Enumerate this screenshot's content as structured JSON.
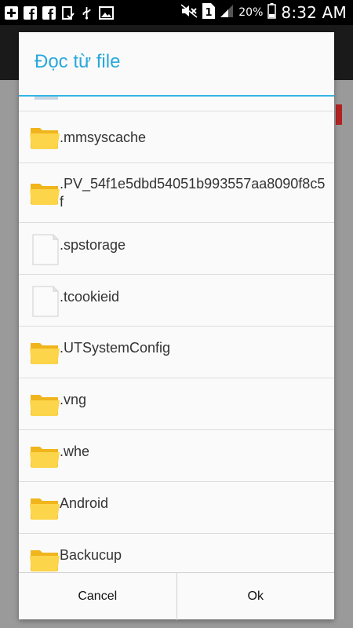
{
  "status_bar": {
    "battery_percent": "20%",
    "time": "8:32 AM",
    "left_icons": [
      "plus-icon",
      "facebook-icon",
      "facebook-icon",
      "clipboard-check-icon",
      "usb-icon",
      "image-icon"
    ],
    "right_icons": [
      "mute-icon",
      "sim-1-icon",
      "signal-icon",
      "battery-icon"
    ]
  },
  "dialog": {
    "title": "Đọc từ file",
    "items": [
      {
        "name": ".mmsyscache",
        "kind": "folder"
      },
      {
        "name": ".PV_54f1e5dbd54051b993557aa8090f8c5f",
        "kind": "folder"
      },
      {
        "name": ".spstorage",
        "kind": "file"
      },
      {
        "name": ".tcookieid",
        "kind": "file"
      },
      {
        "name": ".UTSystemConfig",
        "kind": "folder"
      },
      {
        "name": ".vng",
        "kind": "folder"
      },
      {
        "name": ".whe",
        "kind": "folder"
      },
      {
        "name": "Android",
        "kind": "folder"
      },
      {
        "name": "Backucup",
        "kind": "folder"
      }
    ],
    "cancel_label": "Cancel",
    "ok_label": "Ok"
  },
  "colors": {
    "title": "#28a8dc",
    "divider": "#33b5e5",
    "folder": "#f5c02b"
  }
}
